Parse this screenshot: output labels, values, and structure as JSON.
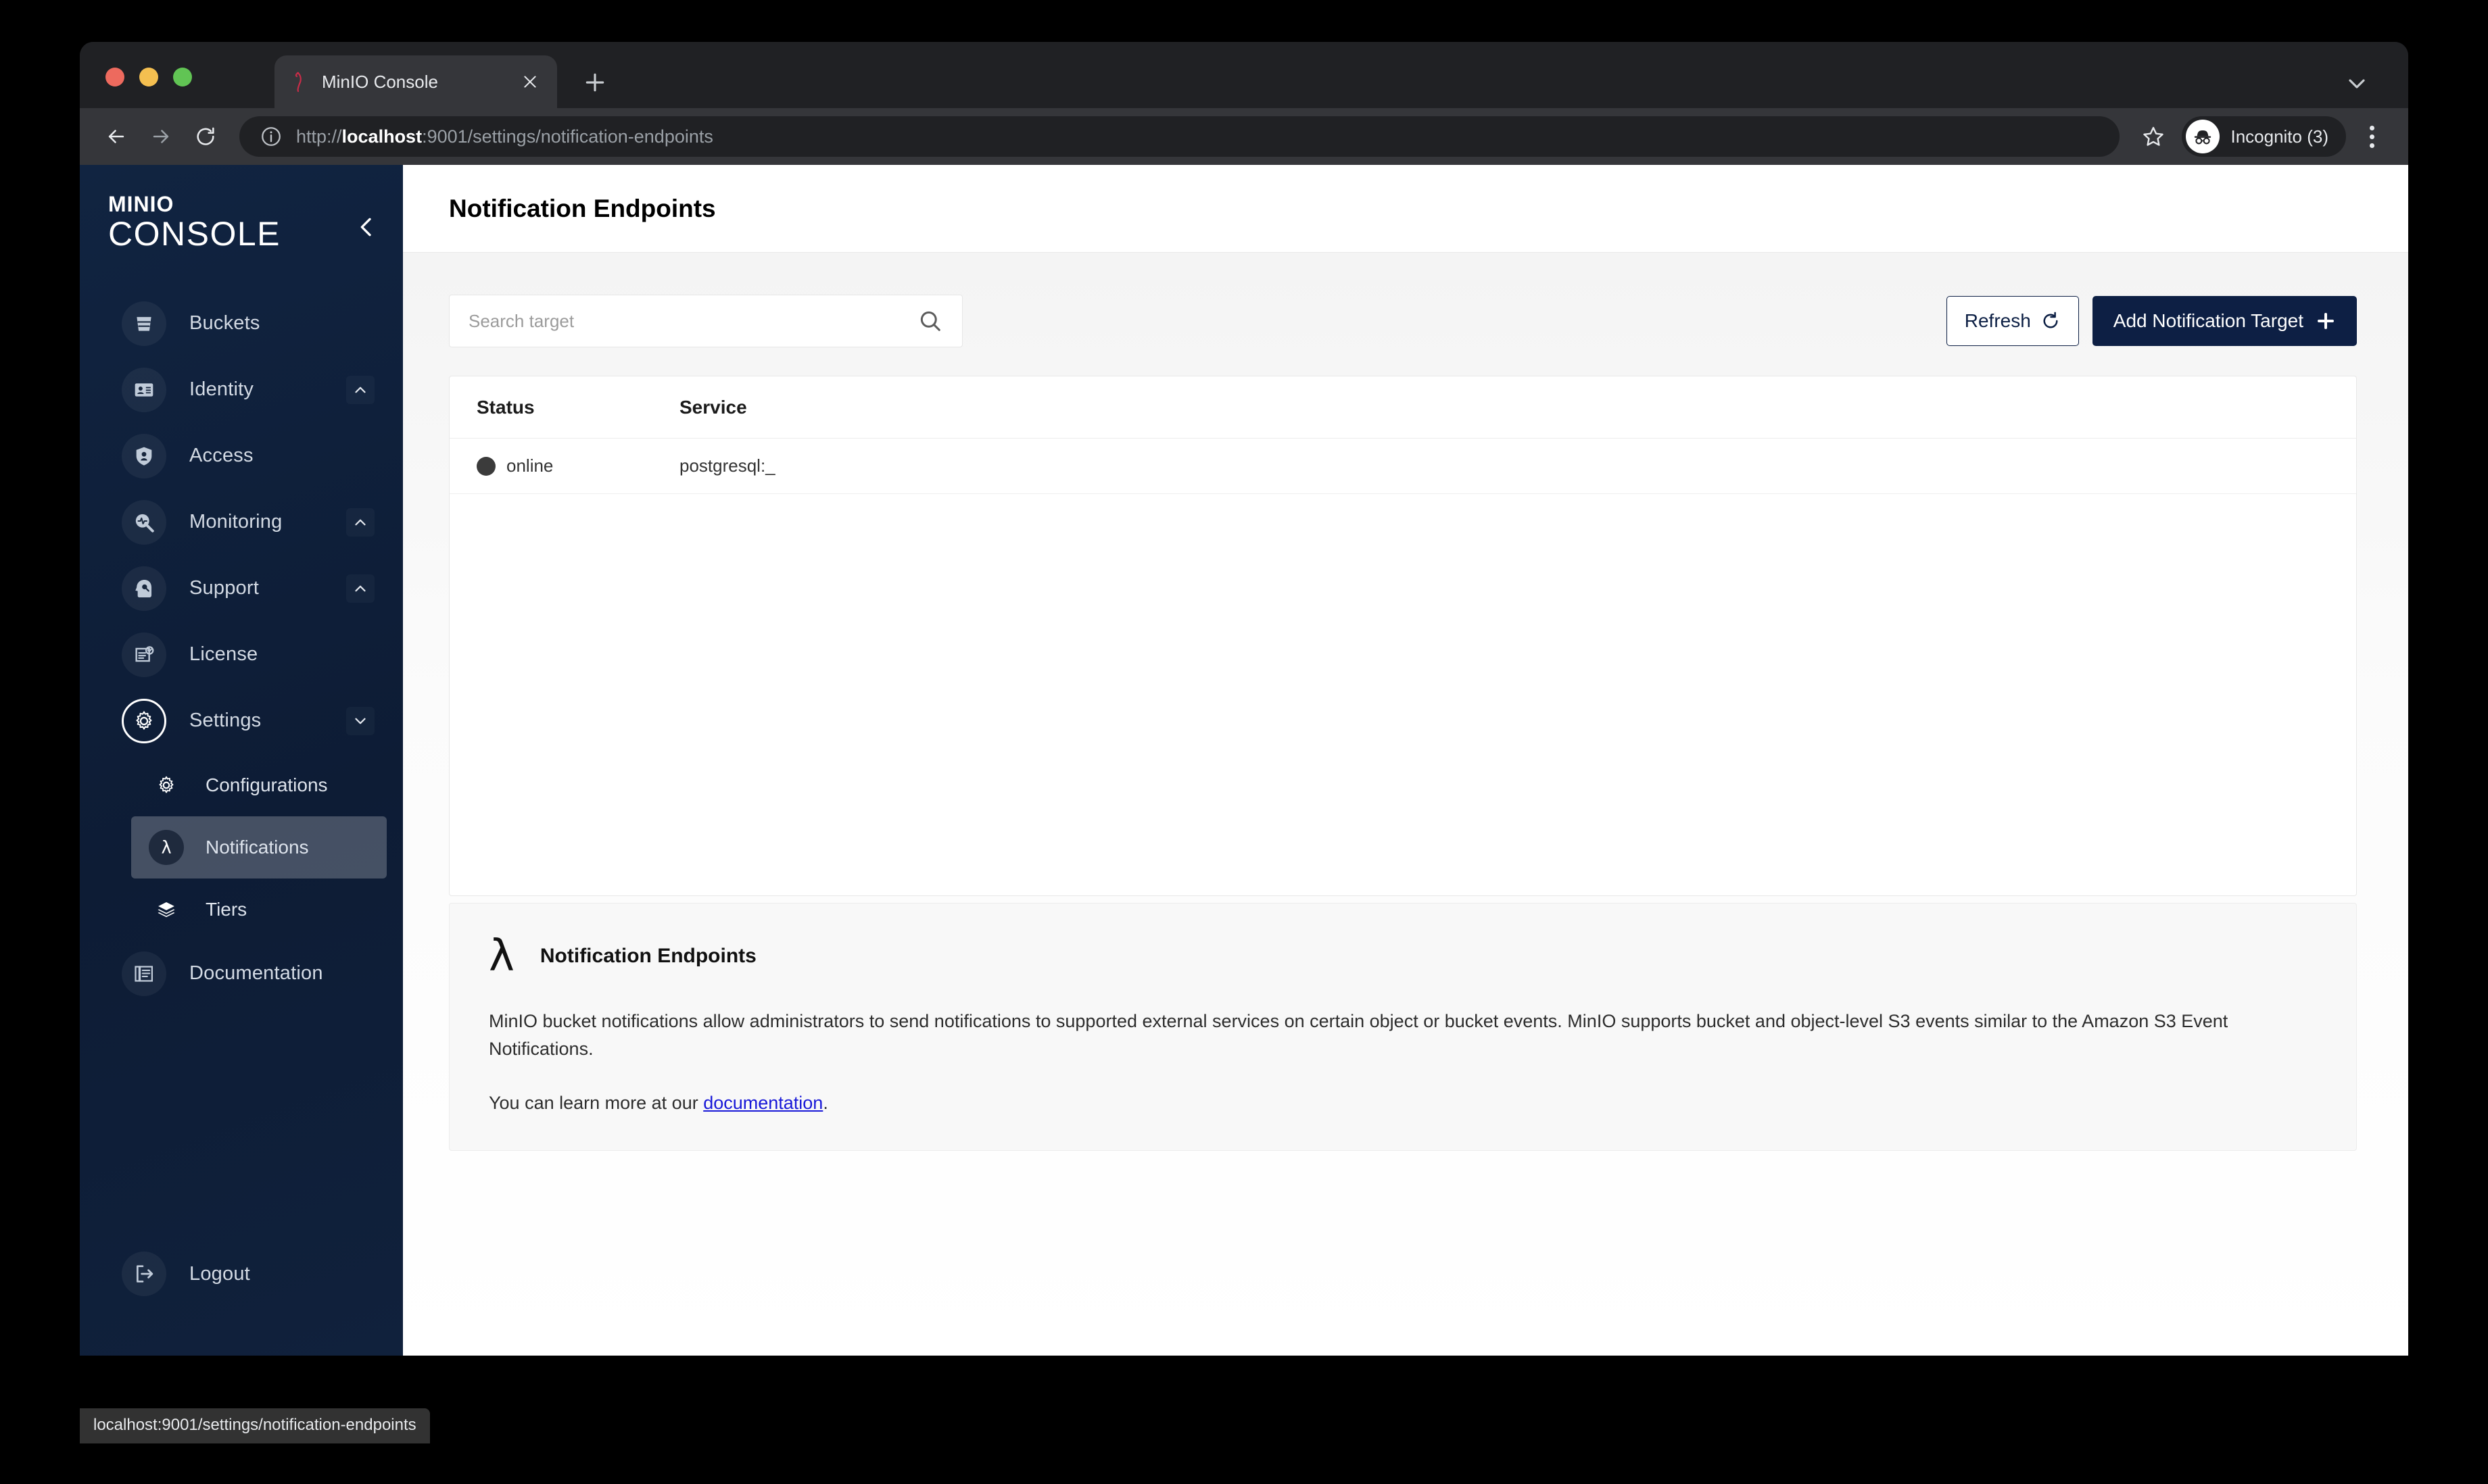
{
  "browser": {
    "tab": {
      "title": "MinIO Console",
      "favicon_icon": "minio-flamingo-icon",
      "close_icon": "close-icon"
    },
    "new_tab_icon": "plus-icon",
    "tabstrip_chevron_icon": "chevron-down-icon",
    "nav": {
      "back_icon": "arrow-left-icon",
      "forward_icon": "arrow-right-icon",
      "reload_icon": "reload-icon"
    },
    "omnibox": {
      "info_icon": "info-circle-icon",
      "scheme": "http://",
      "host": "localhost",
      "path": ":9001/settings/notification-endpoints",
      "full_url": "http://localhost:9001/settings/notification-endpoints"
    },
    "star_icon": "star-icon",
    "profile": {
      "label": "Incognito (3)",
      "icon": "incognito-icon"
    },
    "menu_icon": "three-dots-vertical-icon",
    "traffic_lights": [
      "close",
      "minimize",
      "zoom"
    ]
  },
  "status_bar": {
    "url": "localhost:9001/settings/notification-endpoints"
  },
  "sidebar": {
    "logo_top": "MINIO",
    "logo_bottom": "CONSOLE",
    "collapse_icon": "chevron-left-icon",
    "items": [
      {
        "label": "Buckets",
        "icon": "bucket-icon",
        "chevron": null
      },
      {
        "label": "Identity",
        "icon": "identity-card-icon",
        "chevron": "chevron-up-icon"
      },
      {
        "label": "Access",
        "icon": "lock-shield-icon",
        "chevron": null
      },
      {
        "label": "Monitoring",
        "icon": "monitoring-magnifier-icon",
        "chevron": "chevron-up-icon"
      },
      {
        "label": "Support",
        "icon": "support-head-icon",
        "chevron": "chevron-up-icon"
      },
      {
        "label": "License",
        "icon": "license-check-icon",
        "chevron": null
      },
      {
        "label": "Settings",
        "icon": "gear-icon",
        "chevron": "chevron-down-icon",
        "active": true
      }
    ],
    "sub_items": [
      {
        "label": "Configurations",
        "icon": "gear-icon",
        "selected": false
      },
      {
        "label": "Notifications",
        "icon": "lambda-icon",
        "selected": true
      },
      {
        "label": "Tiers",
        "icon": "layers-icon",
        "selected": false
      }
    ],
    "documentation": {
      "label": "Documentation",
      "icon": "documentation-icon"
    },
    "logout": {
      "label": "Logout",
      "icon": "logout-icon"
    }
  },
  "header": {
    "title": "Notification Endpoints"
  },
  "search": {
    "placeholder": "Search target",
    "value": "",
    "icon": "search-icon"
  },
  "toolbar": {
    "refresh_label": "Refresh",
    "refresh_icon": "refresh-icon",
    "add_label": "Add Notification Target",
    "add_icon": "plus-icon"
  },
  "table": {
    "columns": [
      "Status",
      "Service"
    ],
    "rows": [
      {
        "status": "online",
        "service": "postgresql:_",
        "status_color": "#3b3b3b"
      }
    ]
  },
  "info_panel": {
    "icon": "lambda-icon",
    "lambda_glyph": "λ",
    "title": "Notification Endpoints",
    "body": "MinIO bucket notifications allow administrators to send notifications to supported external services on certain object or bucket events. MinIO supports bucket and object-level S3 events similar to the Amazon S3 Event Notifications.",
    "more_prefix": "You can learn more at our ",
    "link_text": "documentation",
    "more_suffix": "."
  },
  "colors": {
    "sidebar_bg": "#0d1c35",
    "accent": "#0d1f44",
    "link": "#1818d8",
    "status_online": "#3b3b3b"
  }
}
